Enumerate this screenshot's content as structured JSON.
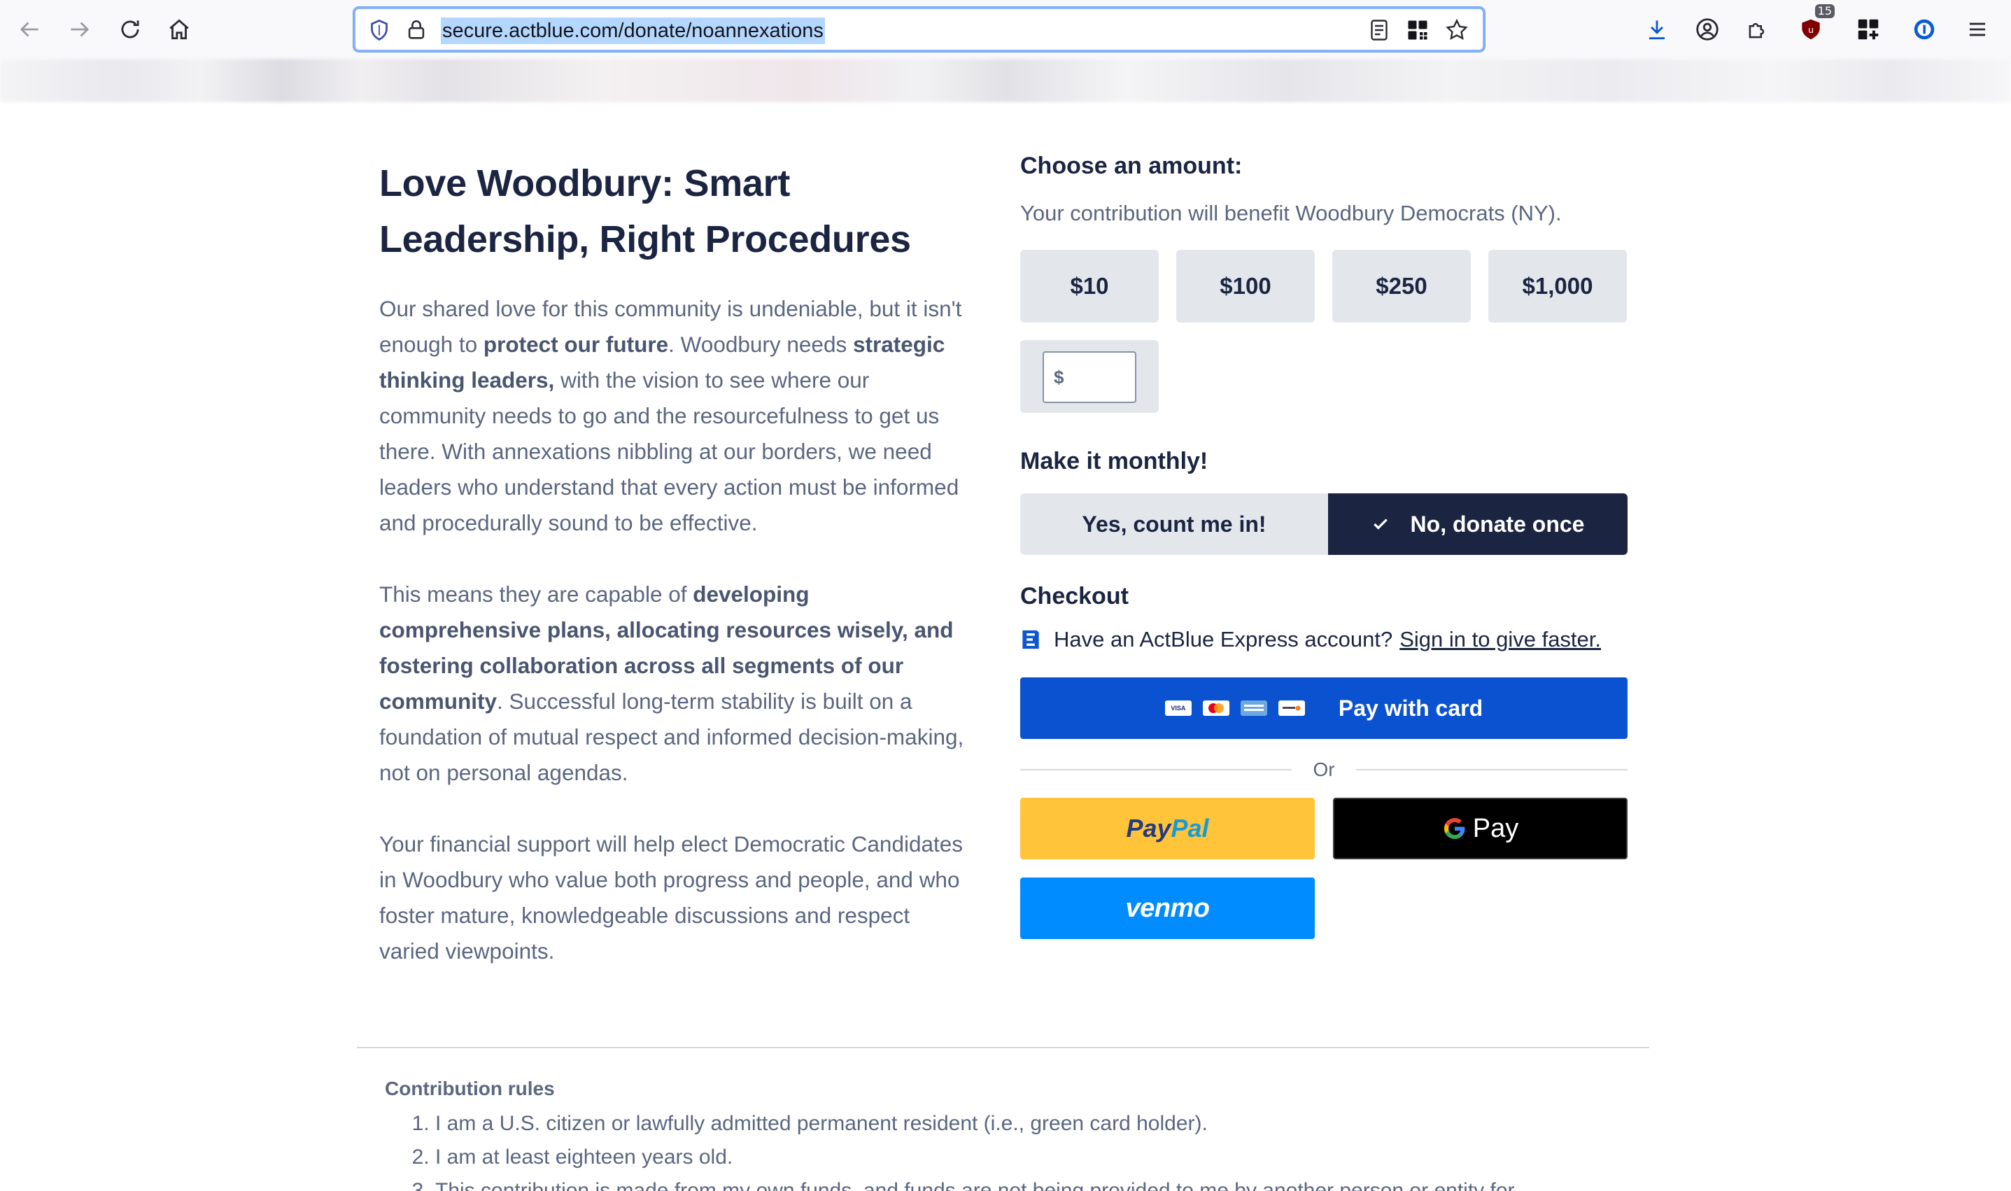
{
  "browser": {
    "url": "secure.actblue.com/donate/noannexations",
    "extension_badge": "15"
  },
  "page": {
    "headline": "Love Woodbury: Smart Leadership, Right Procedures",
    "p1": {
      "t1": "Our shared love for this community is undeniable, but it isn't enough to ",
      "b1": "protect our future",
      "t2": ". Woodbury needs ",
      "b2": "strategic thinking leaders,",
      "t3": " with the vision to see where our community needs to go and the resourcefulness to get us there. With annexations nibbling at our borders, we need leaders who understand that every action must be informed and procedurally sound to be effective."
    },
    "p2": {
      "t1": "This means they are capable of ",
      "b1": "developing comprehensive plans, allocating resources wisely, and fostering collaboration across all segments of our community",
      "t2": ". Successful long-term stability is built on a foundation of mutual respect and informed decision-making, not on personal agendas."
    },
    "p3": "Your financial support will help elect Democratic Candidates in Woodbury who value both progress and people, and who foster mature, knowledgeable discussions and respect varied viewpoints."
  },
  "donate": {
    "choose_title": "Choose an amount:",
    "benefit": "Your contribution will benefit Woodbury Democrats (NY).",
    "amounts": [
      "$10",
      "$100",
      "$250",
      "$1,000"
    ],
    "other_symbol": "$",
    "monthly_title": "Make it monthly!",
    "monthly_yes": "Yes, count me in!",
    "monthly_no": "No, donate once",
    "monthly_selected": "No, donate once",
    "checkout_title": "Checkout",
    "express_text": "Have an ActBlue Express account?",
    "express_link": "Sign in to give faster.",
    "pay_card": "Pay with card",
    "or": "Or",
    "paypal_a": "Pay",
    "paypal_b": "Pal",
    "gpay": "Pay",
    "venmo": "venmo"
  },
  "rules": {
    "title": "Contribution rules",
    "items": [
      "I am a U.S. citizen or lawfully admitted permanent resident (i.e., green card holder).",
      "I am at least eighteen years old.",
      "This contribution is made from my own funds, and funds are not being provided to me by another person or entity for"
    ]
  },
  "colors": {
    "primary": "#0b52d1",
    "navy": "#1b2542",
    "paypal_yellow": "#ffc43a",
    "venmo_blue": "#008cff"
  }
}
